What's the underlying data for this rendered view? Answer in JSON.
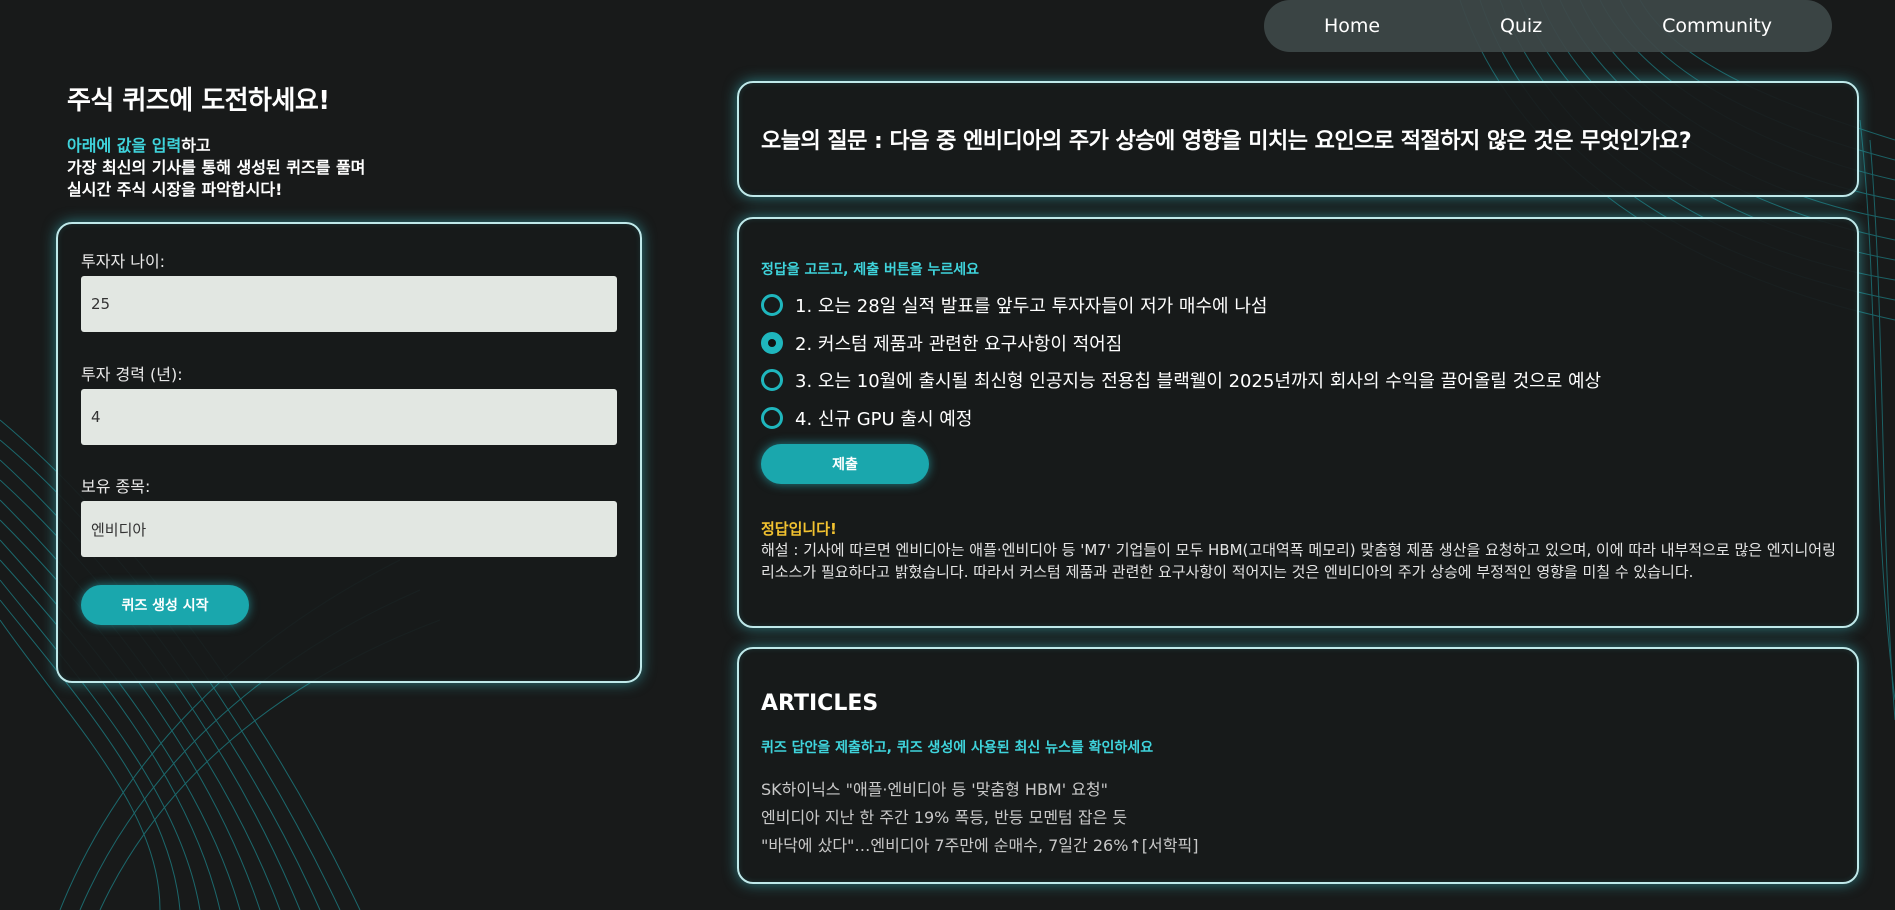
{
  "nav": {
    "items": [
      "Home",
      "Quiz",
      "Community"
    ]
  },
  "left": {
    "title": "주식 퀴즈에 도전하세요!",
    "intro_accent": "아래에 값을 입력",
    "intro_rest": "하고",
    "intro_line2": "가장 최신의 기사를 통해 생성된 퀴즈를 풀며",
    "intro_line3": "실시간 주식 시장을 파악합시다!"
  },
  "form": {
    "age_label": "투자자 나이:",
    "age_value": "25",
    "experience_label": "투자 경력 (년):",
    "experience_value": "4",
    "holding_label": "보유 종목:",
    "holding_value": "엔비디아",
    "generate_button": "퀴즈 생성 시작"
  },
  "question": {
    "text": "오늘의 질문 : 다음 중 엔비디아의 주가 상승에 영향을 미치는 요인으로 적절하지 않은 것은 무엇인가요?"
  },
  "answers": {
    "instruction": "정답을 고르고, 제출 버튼을 누르세요",
    "options": [
      {
        "label": "1. 오는 28일 실적 발표를 앞두고 투자자들이 저가 매수에 나섬",
        "selected": false
      },
      {
        "label": "2. 커스텀 제품과 관련한 요구사항이 적어짐",
        "selected": true
      },
      {
        "label": "3. 오는 10월에 출시될 최신형 인공지능 전용칩 블랙웰이 2025년까지 회사의 수익을 끌어올릴 것으로 예상",
        "selected": false
      },
      {
        "label": "4. 신규 GPU 출시 예정",
        "selected": false
      }
    ],
    "submit_button": "제출",
    "result": "정답입니다!",
    "explanation": "해설 : 기사에 따르면 엔비디아는 애플·엔비디아 등 'M7' 기업들이 모두 HBM(고대역폭 메모리) 맞춤형 제품 생산을 요청하고 있으며, 이에 따라 내부적으로 많은 엔지니어링 리소스가 필요하다고 밝혔습니다. 따라서 커스텀 제품과 관련한 요구사항이 적어지는 것은 엔비디아의 주가 상승에 부정적인 영향을 미칠 수 있습니다."
  },
  "articles": {
    "title": "ARTICLES",
    "subtitle": "퀴즈 답안을 제출하고, 퀴즈 생성에 사용된 최신 뉴스를 확인하세요",
    "items": [
      "SK하이닉스 \"애플·엔비디아 등 '맞춤형 HBM' 요청\"",
      "엔비디아 지난 한 주간 19% 폭등, 반등 모멘텀 잡은 듯",
      "\"바닥에 샀다\"…엔비디아 7주만에 순매수, 7일간 26%↑[서학픽]"
    ]
  },
  "colors": {
    "accent": "#3fd4dc",
    "button": "#1aa7ad",
    "result": "#f2c230",
    "background": "#181a1a"
  }
}
